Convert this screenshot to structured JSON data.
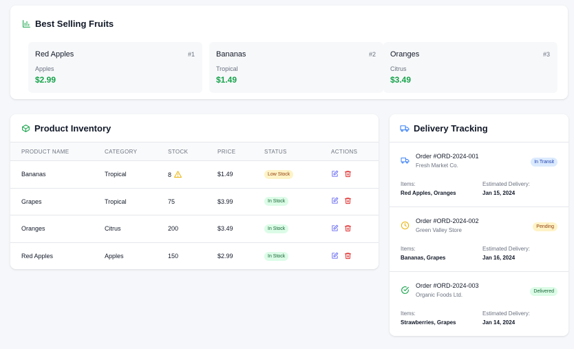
{
  "colors": {
    "accent_green": "#16a34a",
    "icon_edit": "#6366f1",
    "icon_delete": "#dc2626",
    "truck_blue": "#3b82f6",
    "clock_amber": "#eab308"
  },
  "best_selling": {
    "title": "Best Selling Fruits",
    "icon": "bar-chart-icon",
    "items": [
      {
        "name": "Red Apples",
        "rank": "#1",
        "category": "Apples",
        "price": "$2.99"
      },
      {
        "name": "Bananas",
        "rank": "#2",
        "category": "Tropical",
        "price": "$1.49"
      },
      {
        "name": "Oranges",
        "rank": "#3",
        "category": "Citrus",
        "price": "$3.49"
      }
    ]
  },
  "inventory": {
    "title": "Product Inventory",
    "icon": "box-icon",
    "columns": [
      "PRODUCT NAME",
      "CATEGORY",
      "STOCK",
      "PRICE",
      "STATUS",
      "ACTIONS"
    ],
    "rows": [
      {
        "name": "Bananas",
        "category": "Tropical",
        "stock": "8",
        "price": "$1.49",
        "status": "Low Stock",
        "warning": true
      },
      {
        "name": "Grapes",
        "category": "Tropical",
        "stock": "75",
        "price": "$3.99",
        "status": "In Stock",
        "warning": false
      },
      {
        "name": "Oranges",
        "category": "Citrus",
        "stock": "200",
        "price": "$3.49",
        "status": "In Stock",
        "warning": false
      },
      {
        "name": "Red Apples",
        "category": "Apples",
        "stock": "150",
        "price": "$2.99",
        "status": "In Stock",
        "warning": false
      }
    ]
  },
  "delivery": {
    "title": "Delivery Tracking",
    "icon": "truck-icon",
    "items_label": "Items:",
    "eta_label": "Estimated Delivery:",
    "orders": [
      {
        "id": "Order #ORD-2024-001",
        "store": "Fresh Market Co.",
        "status": "In Transit",
        "icon": "truck-icon",
        "items": "Red Apples, Oranges",
        "eta": "Jan 15, 2024"
      },
      {
        "id": "Order #ORD-2024-002",
        "store": "Green Valley Store",
        "status": "Pending",
        "icon": "clock-icon",
        "items": "Bananas, Grapes",
        "eta": "Jan 16, 2024"
      },
      {
        "id": "Order #ORD-2024-003",
        "store": "Organic Foods Ltd.",
        "status": "Delivered",
        "icon": "check-circle-icon",
        "items": "Strawberries, Grapes",
        "eta": "Jan 14, 2024"
      }
    ]
  }
}
